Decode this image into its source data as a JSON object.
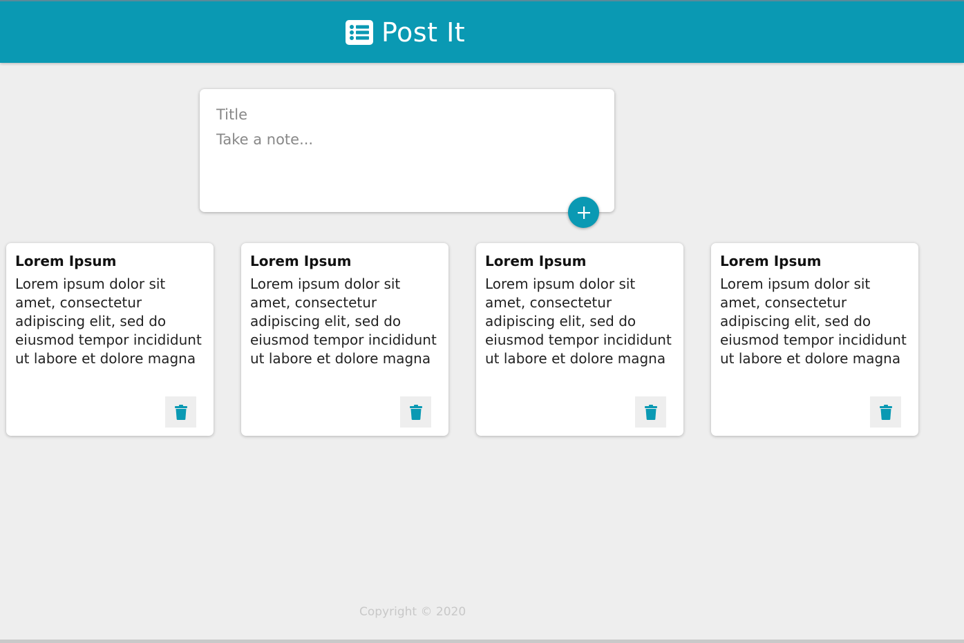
{
  "header": {
    "title": "Post It",
    "icon": "list-icon",
    "accent_color": "#0a99b3"
  },
  "compose": {
    "title_placeholder": "Title",
    "note_placeholder": "Take a note...",
    "add_icon": "plus-icon"
  },
  "notes": [
    {
      "title": "Lorem Ipsum",
      "content": "Lorem ipsum dolor sit amet, consectetur adipiscing elit, sed do eiusmod tempor incididunt ut labore et dolore magna"
    },
    {
      "title": "Lorem Ipsum",
      "content": "Lorem ipsum dolor sit amet, consectetur adipiscing elit, sed do eiusmod tempor incididunt ut labore et dolore magna"
    },
    {
      "title": "Lorem Ipsum",
      "content": "Lorem ipsum dolor sit amet, consectetur adipiscing elit, sed do eiusmod tempor incididunt ut labore et dolore magna"
    },
    {
      "title": "Lorem Ipsum",
      "content": "Lorem ipsum dolor sit amet, consectetur adipiscing elit, sed do eiusmod tempor incididunt ut labore et dolore magna"
    }
  ],
  "footer": {
    "copyright": "Copyright © 2020"
  }
}
